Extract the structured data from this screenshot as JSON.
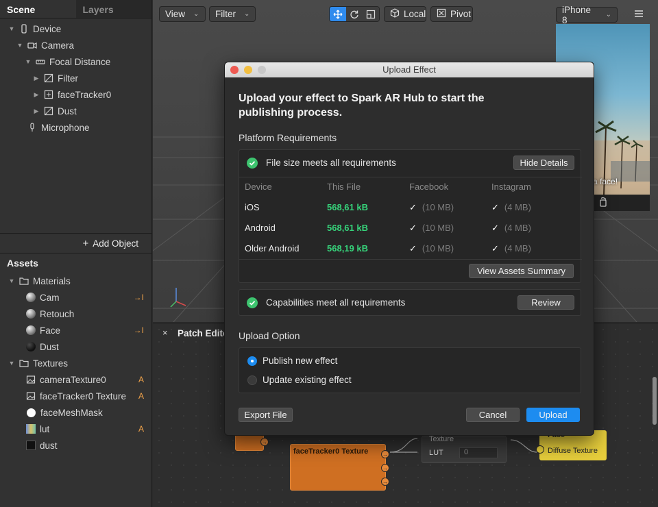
{
  "left_panel": {
    "tabs": [
      "Scene",
      "Layers"
    ],
    "scene_tree": [
      {
        "label": "Device",
        "icon": "phone-icon"
      },
      {
        "label": "Camera",
        "icon": "camera-icon"
      },
      {
        "label": "Focal Distance",
        "icon": "focal-distance-icon"
      },
      {
        "label": "Filter",
        "icon": "plane-icon"
      },
      {
        "label": "faceTracker0",
        "icon": "face-tracker-icon"
      },
      {
        "label": "Dust",
        "icon": "plane-icon"
      },
      {
        "label": "Microphone",
        "icon": "microphone-icon"
      }
    ],
    "add_object_label": "Add Object",
    "assets_title": "Assets",
    "assets": {
      "materials_label": "Materials",
      "materials": [
        "Cam",
        "Retouch",
        "Face",
        "Dust"
      ],
      "textures_label": "Textures",
      "textures": [
        "cameraTexture0",
        "faceTracker0 Texture",
        "faceMeshMask",
        "lut",
        "dust"
      ],
      "badge_arrow": "→I",
      "badge_a": "A"
    }
  },
  "viewport": {
    "view_label": "View",
    "filter_label": "Filter",
    "local_label": "Local",
    "pivot_label": "Pivot",
    "device_label": "iPhone 8",
    "phone_caption": "a face!"
  },
  "patch_editor": {
    "title": "Patch Edito",
    "node_texture_title": "faceTracker0 Texture",
    "input_texture_label": "Texture",
    "input_lut_label": "LUT",
    "input_value": "0",
    "face_node_title": "Face",
    "face_node_port": "Diffuse Texture"
  },
  "dialog": {
    "window_title": "Upload Effect",
    "headline": "Upload your effect to Spark AR Hub to start the publishing process.",
    "platform_title": "Platform Requirements",
    "file_size_status": "File size meets all requirements",
    "hide_details_label": "Hide Details",
    "columns": [
      "Device",
      "This File",
      "Facebook",
      "Instagram"
    ],
    "rows": [
      {
        "device": "iOS",
        "size": "568,61 kB",
        "facebook": "(10 MB)",
        "instagram": "(4 MB)"
      },
      {
        "device": "Android",
        "size": "568,61 kB",
        "facebook": "(10 MB)",
        "instagram": "(4 MB)"
      },
      {
        "device": "Older Android",
        "size": "568,19 kB",
        "facebook": "(10 MB)",
        "instagram": "(4 MB)"
      }
    ],
    "tick": "✓",
    "view_assets_label": "View Assets Summary",
    "capabilities_status": "Capabilities meet all requirements",
    "review_label": "Review",
    "upload_option_title": "Upload Option",
    "options": [
      "Publish new effect",
      "Update existing effect"
    ],
    "export_label": "Export File",
    "cancel_label": "Cancel",
    "upload_label": "Upload"
  },
  "colors": {
    "accent": "#1d8cf0",
    "success": "#3dc46f",
    "size_text": "#36d27a",
    "badge": "#f1a34a"
  }
}
